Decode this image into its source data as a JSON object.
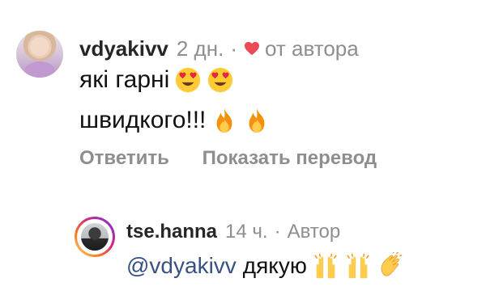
{
  "comment": {
    "username": "vdyakivv",
    "time": "2 дн.",
    "separator": "·",
    "author_liked_label": "от автора",
    "text_line1": "які гарні",
    "text_line2": "швидкого!!!",
    "emoji_line1": [
      "heart-eyes",
      "heart-eyes"
    ],
    "emoji_line2": [
      "fire",
      "fire"
    ],
    "reply_label": "Ответить",
    "translate_label": "Показать перевод"
  },
  "reply": {
    "username": "tse.hanna",
    "time": "14 ч.",
    "separator": "·",
    "author_badge": "Автор",
    "mention": "@vdyakivv",
    "text": "дякую",
    "emoji": [
      "raising-hands",
      "raising-hands",
      "clapping-hands"
    ]
  },
  "colors": {
    "heart": "#ed4956",
    "mention": "#385185",
    "muted": "#8e8e8e"
  }
}
